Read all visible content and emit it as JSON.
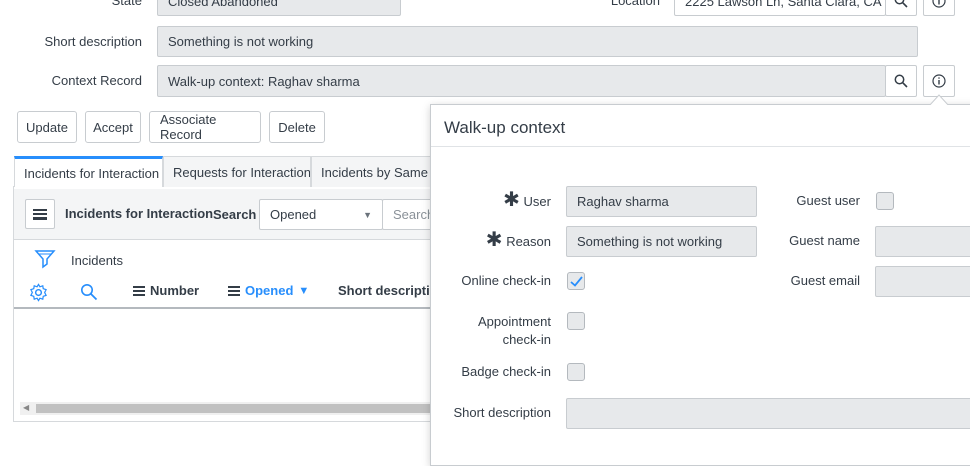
{
  "form": {
    "state_label": "State",
    "state_value": "Closed Abandoned",
    "location_label": "Location",
    "location_value": "2225 Lawson Ln, Santa Clara, CA",
    "short_description_label": "Short description",
    "short_description_value": "Something is not working",
    "context_record_label": "Context Record",
    "context_record_value": "Walk-up context: Raghav sharma"
  },
  "buttons": {
    "update": "Update",
    "accept": "Accept",
    "associate_record": "Associate Record",
    "delete": "Delete"
  },
  "tabs": [
    {
      "label": "Incidents for Interaction",
      "active": true
    },
    {
      "label": "Requests for Interaction",
      "active": false
    },
    {
      "label": "Incidents by Same Caller",
      "active": false
    }
  ],
  "list": {
    "title": "Incidents for Interaction",
    "search_label": "Search",
    "filter_selected": "Opened",
    "search_placeholder": "Search",
    "breadcrumb": "Incidents",
    "columns": [
      {
        "label": "Number"
      },
      {
        "label": "Opened",
        "sorted": "desc"
      },
      {
        "label": "Short description"
      }
    ]
  },
  "popup": {
    "title": "Walk-up context",
    "user_label": "User",
    "user_value": "Raghav sharma",
    "reason_label": "Reason",
    "reason_value": "Something is not working",
    "online_checkin_label": "Online check-in",
    "online_checkin_checked": true,
    "appointment_checkin_label": "Appointment check-in",
    "appointment_checkin_checked": false,
    "badge_checkin_label": "Badge check-in",
    "badge_checkin_checked": false,
    "short_description_label": "Short description",
    "short_description_value": "",
    "guest_user_label": "Guest user",
    "guest_user_checked": false,
    "guest_name_label": "Guest name",
    "guest_name_value": "",
    "guest_email_label": "Guest email",
    "guest_email_value": ""
  },
  "colors": {
    "accent": "#278efc",
    "field_bg": "#e7e9eb",
    "text": "#343d47"
  }
}
